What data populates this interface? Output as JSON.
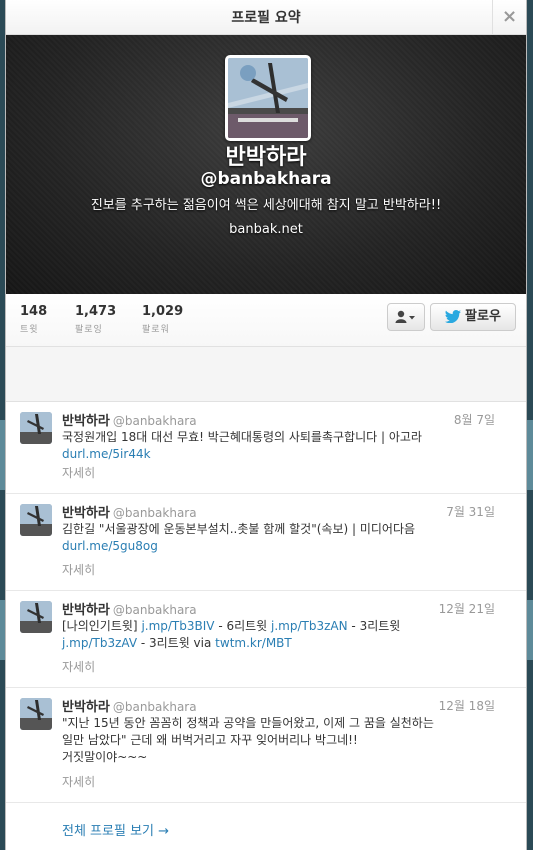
{
  "modal": {
    "title": "프로필 요약",
    "close_label": "×"
  },
  "profile": {
    "name": "반박하라",
    "handle": "@banbakhara",
    "bio": "진보를 추구하는 젊음이여 썩은 세상에대해 참지 말고 반박하라!!",
    "url": "banbak.net"
  },
  "stats": [
    {
      "value": "148",
      "label": "트윗"
    },
    {
      "value": "1,473",
      "label": "팔로잉"
    },
    {
      "value": "1,029",
      "label": "팔로워"
    }
  ],
  "actions": {
    "user_menu_icon": "person-icon",
    "follow_label": "팔로우",
    "follow_icon": "bird-icon"
  },
  "tweets": [
    {
      "name": "반박하라",
      "handle": "@banbakhara",
      "time": "8월 7일",
      "line1": "국정원개입 18대 대선 무효! 박근혜대통령의 사퇴를촉구합니다 | 아고라",
      "link1": "durl.me/5ir44k",
      "expand": "자세히"
    },
    {
      "name": "반박하라",
      "handle": "@banbakhara",
      "time": "7월 31일",
      "line1": "김한길 \"서울광장에 운동본부설치..촛불 함께 할것\"(속보) | 미디어다음",
      "link1": "durl.me/5gu8og",
      "expand": "자세히"
    },
    {
      "name": "반박하라",
      "handle": "@banbakhara",
      "time": "12월 21일",
      "prefix": "[나의인기트윗]",
      "link_a": "j.mp/Tb3BIV",
      "text_a": " - 6리트윗 ",
      "link_b": "j.mp/Tb3zAN",
      "text_b": " - 3리트윗",
      "link_c": "j.mp/Tb3zAV",
      "text_c": " - 3리트윗 via ",
      "link_d": "twtm.kr/MBT",
      "expand": "자세히"
    },
    {
      "name": "반박하라",
      "handle": "@banbakhara",
      "time": "12월 18일",
      "line1": "\"지난 15년 동안 꼼꼼히 정책과 공약을 만들어왔고, 이제 그 꿈을 실천하는",
      "line2": "일만 남았다\" 근데 왜 버벅거리고 자꾸 잊어버리나 박그네!!",
      "line3": "거짓말이야~~~",
      "expand": "자세히"
    }
  ],
  "footer": {
    "full_profile_label": "전체 프로필 보기 →"
  }
}
